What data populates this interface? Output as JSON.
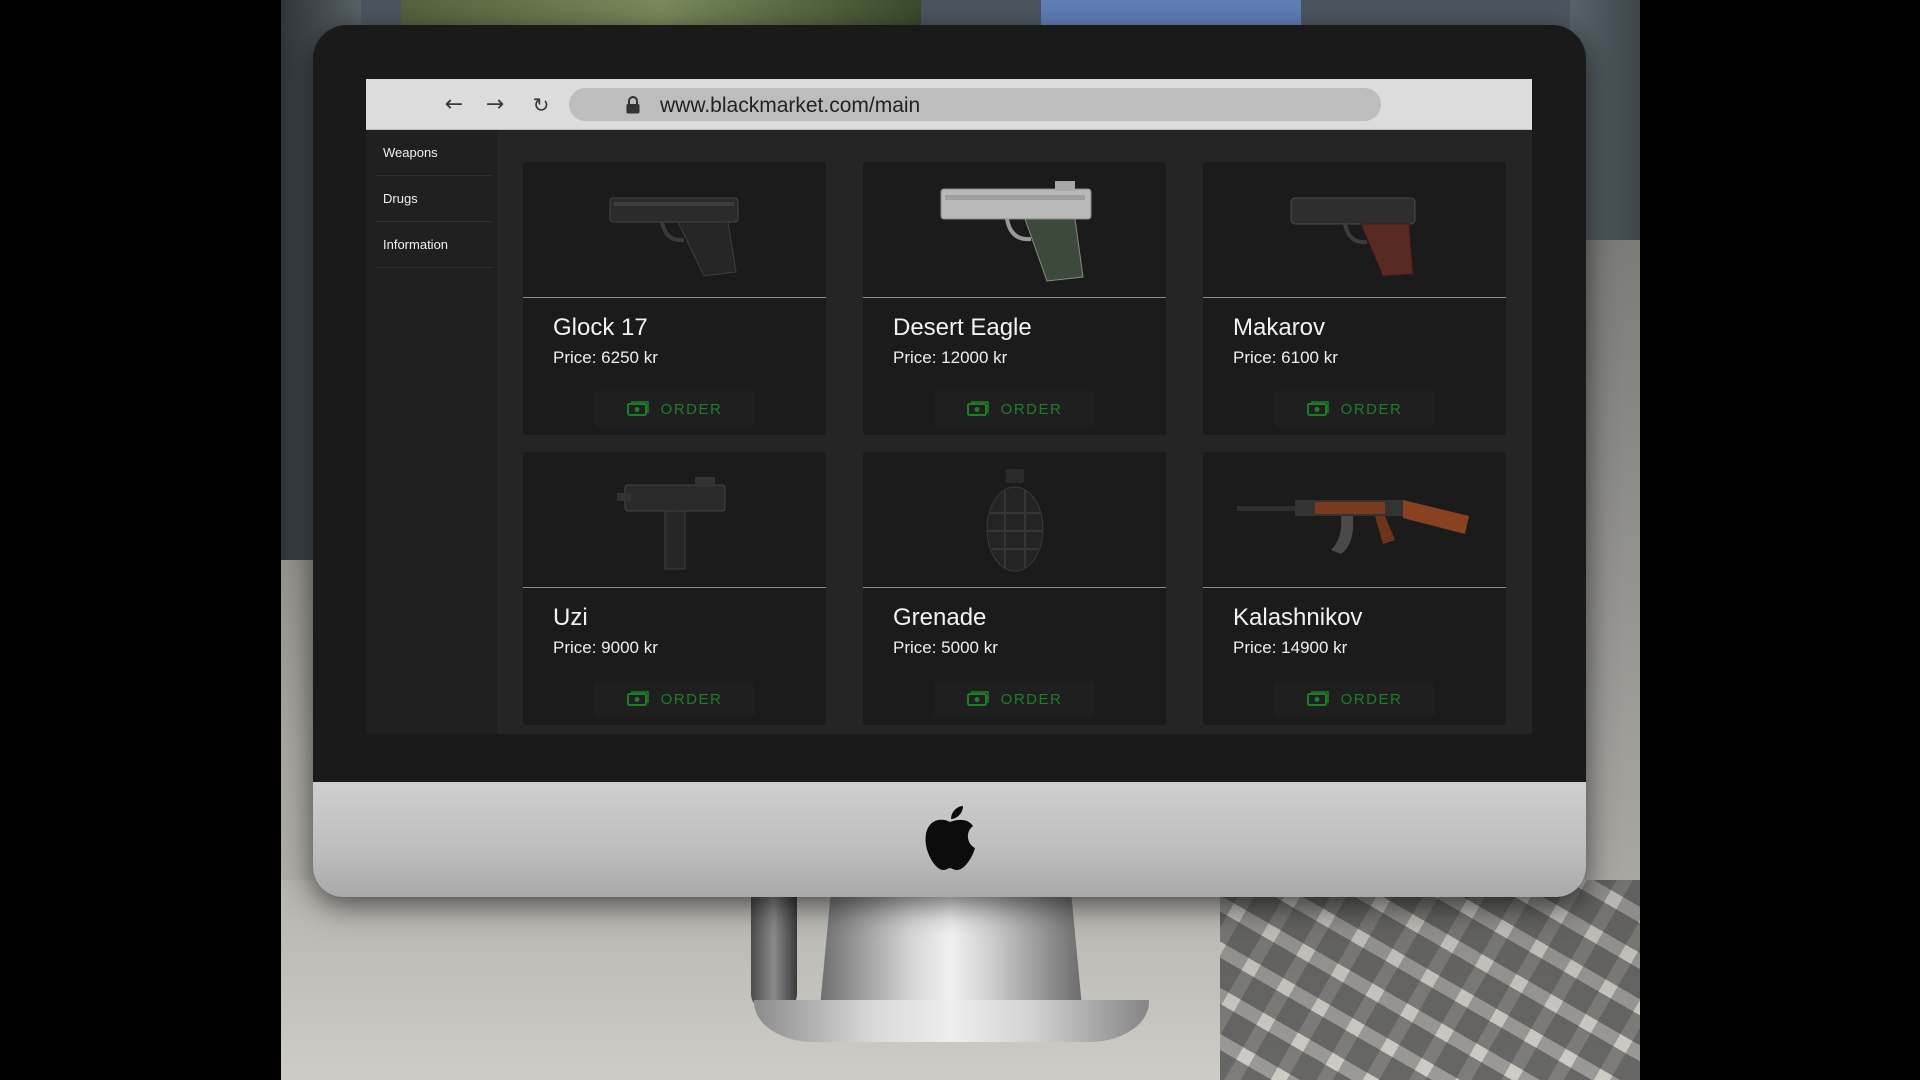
{
  "browser": {
    "url": "www.blackmarket.com/main",
    "back_symbol": "←",
    "forward_symbol": "→",
    "reload_symbol": "↻"
  },
  "sidebar": {
    "items": [
      {
        "label": "Weapons"
      },
      {
        "label": "Drugs"
      },
      {
        "label": "Information"
      }
    ]
  },
  "products": [
    {
      "name": "Glock 17",
      "price": "Price: 6250 kr",
      "order_label": "ORDER",
      "icon": "pistol-icon"
    },
    {
      "name": "Desert Eagle",
      "price": "Price: 12000 kr",
      "order_label": "ORDER",
      "icon": "pistol-icon"
    },
    {
      "name": "Makarov",
      "price": "Price: 6100 kr",
      "order_label": "ORDER",
      "icon": "pistol-icon"
    },
    {
      "name": "Uzi",
      "price": "Price: 9000 kr",
      "order_label": "ORDER",
      "icon": "smg-icon"
    },
    {
      "name": "Grenade",
      "price": "Price: 5000 kr",
      "order_label": "ORDER",
      "icon": "grenade-icon"
    },
    {
      "name": "Kalashnikov",
      "price": "Price: 14900 kr",
      "order_label": "ORDER",
      "icon": "rifle-icon"
    }
  ],
  "colors": {
    "order_green": "#1f7d2a",
    "card_bg": "#1b1b1b",
    "page_bg": "#252525"
  }
}
